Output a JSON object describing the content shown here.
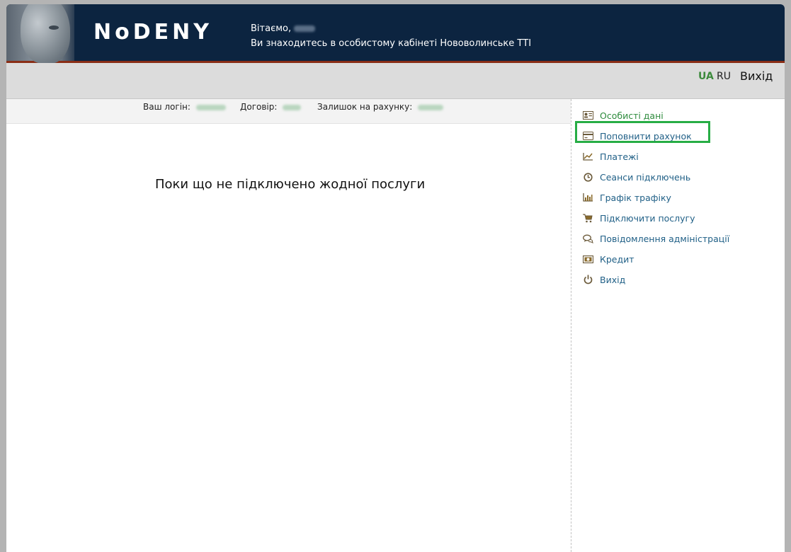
{
  "header": {
    "logo": "NoDENY",
    "greeting": "Вітаємо,",
    "subtitle": "Ви знаходитесь в особистому кабінеті Нововолинське ТТІ"
  },
  "topbar": {
    "lang_ua": "UA",
    "lang_ru": "RU",
    "exit": "Вихід"
  },
  "info": {
    "login_label": "Ваш логін:",
    "contract_label": "Договір:",
    "balance_label": "Залишок на рахунку:"
  },
  "main": {
    "message": "Поки що не підключено жодної послуги"
  },
  "sidebar": {
    "items": [
      {
        "label": "Особисті дані",
        "icon": "id-card-icon"
      },
      {
        "label": "Поповнити рахунок",
        "icon": "credit-card-icon"
      },
      {
        "label": "Платежі",
        "icon": "chart-line-icon"
      },
      {
        "label": "Сеанси підключень",
        "icon": "clock-icon"
      },
      {
        "label": "Графік трафіку",
        "icon": "bar-chart-icon"
      },
      {
        "label": "Підключити послугу",
        "icon": "cart-icon"
      },
      {
        "label": "Повідомлення адміністрації",
        "icon": "chat-icon"
      },
      {
        "label": "Кредит",
        "icon": "banknote-icon"
      },
      {
        "label": "Вихід",
        "icon": "power-icon"
      }
    ]
  },
  "colors": {
    "header_bg": "#0c2440",
    "header_border": "#8a2e16",
    "link": "#1f5f86",
    "active_link": "#2e8b3d",
    "highlight": "#27ad45"
  }
}
